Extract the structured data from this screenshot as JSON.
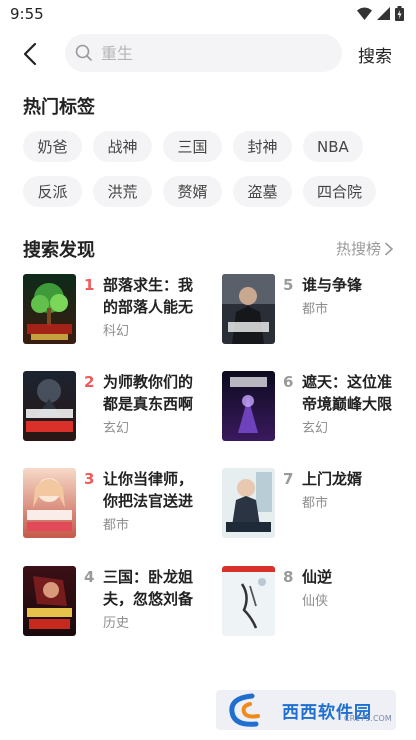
{
  "status_bar": {
    "time": "9:55"
  },
  "search": {
    "placeholder": "重生",
    "button_label": "搜索"
  },
  "hot_tags": {
    "title": "热门标签",
    "tags": [
      "奶爸",
      "战神",
      "三国",
      "封神",
      "NBA",
      "反派",
      "洪荒",
      "赘婿",
      "盗墓",
      "四合院"
    ]
  },
  "discover": {
    "title": "搜索发现",
    "hot_rank_label": "热搜榜",
    "books": [
      {
        "rank": "1",
        "title": "部落求生：我的部落人能无",
        "genre": "科幻"
      },
      {
        "rank": "2",
        "title": "为师教你们的都是真东西啊",
        "genre": "玄幻"
      },
      {
        "rank": "3",
        "title": "让你当律师，你把法官送进",
        "genre": "都市"
      },
      {
        "rank": "4",
        "title": "三国：卧龙姐夫，忽悠刘备",
        "genre": "历史"
      },
      {
        "rank": "5",
        "title": "谁与争锋",
        "genre": "都市"
      },
      {
        "rank": "6",
        "title": "遮天：这位准帝境巅峰大限",
        "genre": "玄幻"
      },
      {
        "rank": "7",
        "title": "上门龙婿",
        "genre": "都市"
      },
      {
        "rank": "8",
        "title": "仙逆",
        "genre": "仙侠"
      }
    ]
  },
  "watermark": {
    "text": "西西软件园",
    "sub": "CR173.COM"
  },
  "colors": {
    "top_rank": "#f05a5a",
    "normal_rank": "#9a9a9a",
    "tag_bg": "#f4f4f6"
  }
}
